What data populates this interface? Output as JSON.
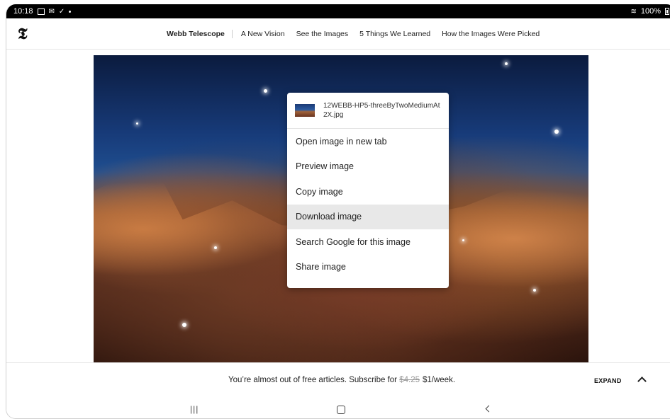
{
  "status_bar": {
    "time": "10:18",
    "battery": "100%",
    "icons": [
      "gallery-icon",
      "mail-icon",
      "download-done-icon",
      "dot-icon",
      "wifi-icon",
      "battery-icon"
    ]
  },
  "header": {
    "logo": "𝕿",
    "brand": "Webb Telescope",
    "links": [
      "A New Vision",
      "See the Images",
      "5 Things We Learned",
      "How the Images Were Picked"
    ]
  },
  "context_menu": {
    "filename": "12WEBB-HP5-threeByTwoMediumAt2X.jpg",
    "items": [
      "Open image in new tab",
      "Preview image",
      "Copy image",
      "Download image",
      "Search Google for this image",
      "Share image"
    ],
    "highlighted_index": 3
  },
  "subscribe": {
    "text_before": "You’re almost out of free articles. Subscribe for",
    "old_price": "$4.25",
    "new_price": "$1/week.",
    "expand_label": "EXPAND"
  },
  "system_nav": {
    "recent_label": "|||"
  }
}
